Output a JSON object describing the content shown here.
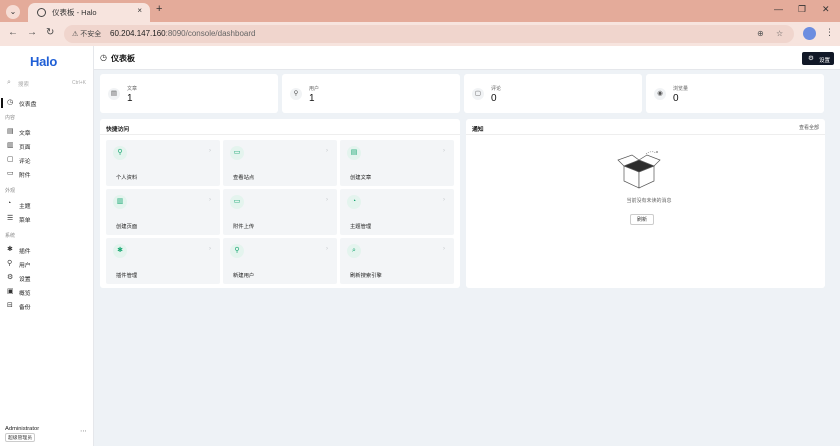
{
  "browser": {
    "tab_title": "仪表板 - Halo",
    "tab_close": "×",
    "new_tab": "+",
    "security_label": "⚠ 不安全",
    "url_host": "60.204.147.160",
    "url_path": ":8090/console/dashboard"
  },
  "sidebar": {
    "logo": "Halo",
    "search_placeholder": "搜索",
    "search_shortcut": "Ctrl+K",
    "dashboard": "仪表盘",
    "group_content": "内容",
    "posts": "文章",
    "pages": "页面",
    "comments": "评论",
    "attachments": "附件",
    "group_appearance": "外观",
    "themes": "主题",
    "menus": "菜单",
    "group_system": "系统",
    "plugins": "插件",
    "users": "用户",
    "settings": "设置",
    "overview": "概览",
    "backups": "备份",
    "user_name": "Administrator",
    "user_role": "超级管理员"
  },
  "header": {
    "title": "仪表板",
    "settings_button": "设置"
  },
  "stats": [
    {
      "label": "文章",
      "value": "1",
      "icon": "document-icon"
    },
    {
      "label": "用户",
      "value": "1",
      "icon": "user-icon"
    },
    {
      "label": "评论",
      "value": "0",
      "icon": "comment-icon"
    },
    {
      "label": "浏览量",
      "value": "0",
      "icon": "eye-icon"
    }
  ],
  "quick_access": {
    "title": "快捷访问",
    "items": [
      "个人资料",
      "查看站点",
      "创建文章",
      "创建页面",
      "附件上传",
      "主题管理",
      "插件管理",
      "新建用户",
      "刷新搜索引擎"
    ]
  },
  "notifications": {
    "title": "通知",
    "view_all": "查看全部",
    "empty_text": "当前没有未读的消息",
    "refresh_button": "刷新"
  }
}
